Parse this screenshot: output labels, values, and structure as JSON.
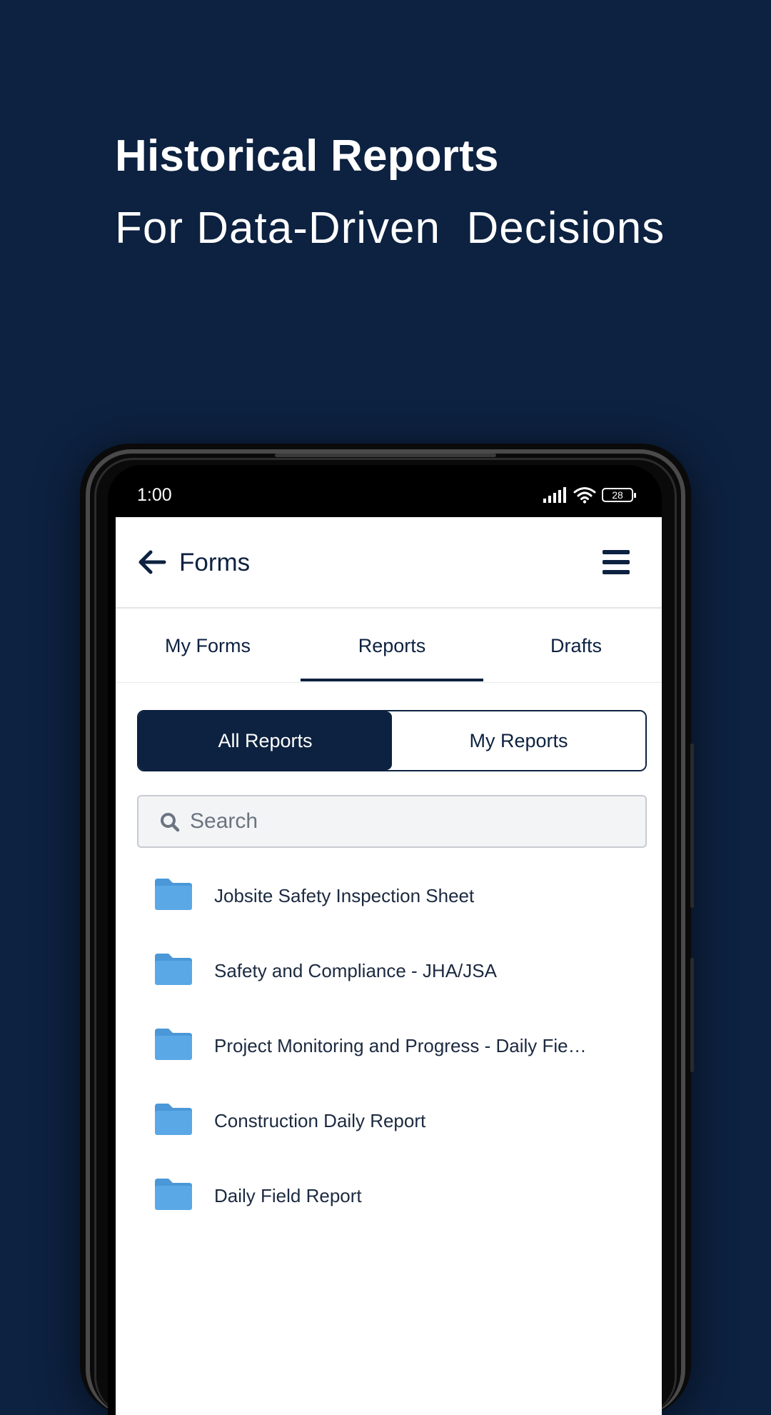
{
  "hero": {
    "title": "Historical Reports",
    "subtitle": "For Data-Driven  Decisions"
  },
  "status_bar": {
    "time": "1:00",
    "battery": "28",
    "icons": [
      "signal-icon",
      "wifi-icon",
      "battery-icon"
    ]
  },
  "header": {
    "title": "Forms",
    "back_icon": "arrow-left-icon",
    "menu_icon": "hamburger-menu-icon"
  },
  "tabs": [
    {
      "label": "My Forms",
      "active": false
    },
    {
      "label": "Reports",
      "active": true
    },
    {
      "label": "Drafts",
      "active": false
    }
  ],
  "segment": {
    "all_reports": "All Reports",
    "my_reports": "My Reports",
    "selected": "All Reports"
  },
  "search": {
    "placeholder": "Search",
    "value": ""
  },
  "reports": [
    {
      "name": "Jobsite Safety Inspection Sheet"
    },
    {
      "name": "Safety and Compliance - JHA/JSA"
    },
    {
      "name": "Project Monitoring and Progress - Daily Fie…"
    },
    {
      "name": "Construction Daily Report"
    },
    {
      "name": "Daily Field Report"
    }
  ],
  "colors": {
    "background": "#0d2140",
    "primary": "#0d2140",
    "folder": "#5aa8e6",
    "text": "#1c2a40"
  }
}
